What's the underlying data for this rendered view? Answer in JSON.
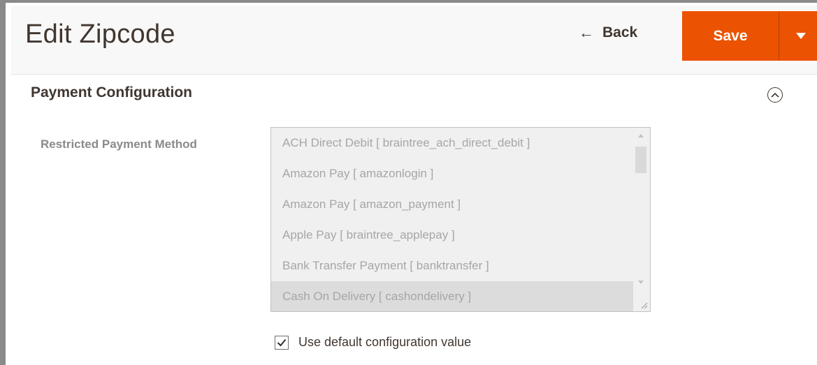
{
  "header": {
    "title": "Edit Zipcode",
    "back_label": "Back",
    "save_label": "Save"
  },
  "section": {
    "title": "Payment Configuration"
  },
  "field": {
    "label": "Restricted Payment Method",
    "options": [
      "ACH Direct Debit [ braintree_ach_direct_debit ]",
      "Amazon Pay [ amazonlogin ]",
      "Amazon Pay [ amazon_payment ]",
      "Apple Pay [ braintree_applepay ]",
      "Bank Transfer Payment [ banktransfer ]",
      "Cash On Delivery [ cashondelivery ]"
    ],
    "selected_option": "Cash On Delivery [ cashondelivery ]",
    "disabled": true
  },
  "default_config": {
    "label": "Use default configuration value",
    "checked": true
  },
  "colors": {
    "accent": "#eb5202",
    "text_dark": "#41362f",
    "text_muted": "#a6a6a6"
  }
}
